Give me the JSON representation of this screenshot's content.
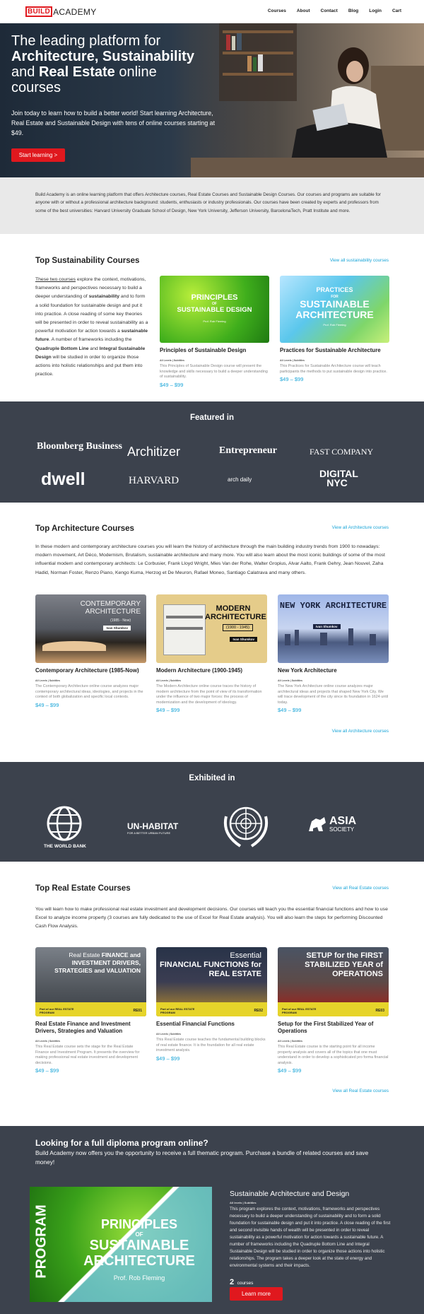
{
  "header": {
    "logo_build": "BUILD",
    "logo_rest": "ACADEMY",
    "nav": [
      "Courses",
      "About",
      "Contact",
      "Blog",
      "Login",
      "Cart"
    ]
  },
  "hero": {
    "line1": "The leading platform for",
    "line2_bold": "Architecture, Sustainability",
    "line3_pre": "and",
    "line3_bold": "Real Estate",
    "line3_post": "online",
    "line4": "courses",
    "text": "Join today to learn how to build a better world! Start learning Architecture, Real Estate and Sustainable Design with tens of online courses starting at $49.",
    "button": "Start learning >"
  },
  "intro": "Build Academy is an online learning platform that offers Architecture courses, Real Estate Courses and Sustainable Design Courses. Our courses and programs are suitable for anyone with or without a professional architecture background: students, enthusiasts or industry professionals. Our courses have been created by experts and professors from some of the best universities: Harvard University Graduate School of Design, New York University, Jefferson University, BarcelonaTech, Pratt Institute and more.",
  "sustainability": {
    "title": "Top Sustainability Courses",
    "link": "View all sustainability courses",
    "text_link": "These two courses",
    "text_a": " explore the context, motivations, frameworks and perspectives necessary to build a deeper understanding of ",
    "text_b1": "sustainability",
    "text_c": " and to form a solid foundation for sustainable design and put it into practice. A close reading of some key theories will be presented in order to reveal sustainability as a powerful motivation for action towards a ",
    "text_b2": "sustainable future",
    "text_d": ". A number of frameworks including the ",
    "text_b3": "Quadruple Bottom Line",
    "text_e": " and ",
    "text_b4": "Integral Sustainable Design",
    "text_f": " will be studied in order to organize those actions into holistic relationships and put them into practice.",
    "courses": [
      {
        "img_title1": "PRINCIPLES",
        "img_of": "OF",
        "img_title2": "SUSTAINABLE DESIGN",
        "img_author": "Prof. Rob Fleming",
        "title": "Principles of Sustainable Design",
        "level": "All Levels | Subtitles",
        "desc": "This Principles of Sustainable Design course will present the knowledge and skills necessary to build a deeper understanding of sustainability.",
        "price": "$49 – $99"
      },
      {
        "img_title1": "PRACTICES",
        "img_of": "FOR",
        "img_title2": "SUSTAINABLE ARCHITECTURE",
        "img_author": "Prof. Rob Fleming",
        "title": "Practices for Sustainable Architecture",
        "level": "All Levels | Subtitles",
        "desc": "This Practices for Sustainable Architecture course will teach participants the methods to put sustainable design into practice.",
        "price": "$49 – $99"
      }
    ]
  },
  "featured": {
    "title": "Featured in",
    "logos": [
      "Bloomberg Business",
      "Architizer",
      "Entrepreneur",
      "FAST COMPANY",
      "dwell",
      "HARVARD",
      "arch daily",
      "DIGITAL NYC"
    ]
  },
  "architecture": {
    "title": "Top Architecture Courses",
    "link": "View all Architecture courses",
    "text": "In these modern and contemporary architecture courses you will learn the history of architecture through the main building industry trends from 1900 to nowadays: modern movement, Art Déco, Modernism, Brutalism, sustainable architecture and many more. You will also learn about the most iconic buildings of some of the most influential modern and contemporary architects: Le Corbusier, Frank Lloyd Wright, Mies Van der Rohe, Walter Gropius, Alvar Aalto, Frank Gehry, Jean Nouvel, Zaha Hadid, Norman Foster, Renzo Piano, Kengo Kuma, Herzog et De Meuron, Rafael Moneo, Santiago Calatrava and many others.",
    "courses": [
      {
        "img_text": "CONTEMPORARY ARCHITECTURE",
        "img_sub": "(1985 - Now)",
        "img_author": "Ivan Shumkov",
        "title": "Contemporary Architecture (1985-Now)",
        "level": "All Levels | Subtitles",
        "desc": "The Contemporary Architecture online course analyzes major contemporary architectural ideas, ideologies, and projects in the context of both globalization and specific local contexts.",
        "price": "$49 – $99"
      },
      {
        "img_text": "MODERN ARCHITECTURE",
        "img_sub": "(1900 - 1945)",
        "img_author": "Ivan Shumkov",
        "title": "Modern Architecture (1900-1945)",
        "level": "All Levels | Subtitles",
        "desc": "The Modern Architecture online course traces the history of modern architecture from the point of view of its transformation under the influence of two major forces: the process of modernization and the development of ideology.",
        "price": "$49 – $99"
      },
      {
        "img_text": "NEW YORK ARCHITECTURE",
        "img_sub": "",
        "img_author": "Ivan Shumkov",
        "title": "New York Architecture",
        "level": "All Levels | Subtitles",
        "desc": "The New York Architecture online course analyzes major architectural ideas and projects that shaped New York City. We will trace development of the city since its foundation in 1624 until today.",
        "price": "$49 – $99"
      }
    ],
    "link_bottom": "View all Architecture courses"
  },
  "exhibited": {
    "title": "Exhibited in",
    "logos": [
      "THE WORLD BANK",
      "UN-HABITAT",
      "FOR A BETTER URBAN FUTURE",
      "ASIA",
      "SOCIETY"
    ]
  },
  "realestate": {
    "title": "Top Real Estate Courses",
    "link": "View all Real Estate courses",
    "text": "You will learn how to make professional real estate investment and development decisions. Our courses will teach you the essential financial functions and how to use Excel to analyze income property (3 courses are fully dedicated to the use of Excel for Real Estate analysis). You will also learn the steps for performing Discounted Cash Flow Analysis.",
    "courses": [
      {
        "img_a": "Real Estate",
        "img_b": "FINANCE and INVESTMENT DRIVERS, STRATEGIES and VALUATION",
        "program": "Part of our REAL ESTATE PROGRAM",
        "code": "RE01",
        "title": "Real Estate Finance and Investment Drivers, Strategies and Valuation",
        "level": "All Levels | Subtitles",
        "desc": "This Real Estate course sets the stage for the Real Estate Finance and Investment Program. It presents the overview for making professional real estate investment and development decisions.",
        "price": "$49 – $99"
      },
      {
        "img_a": "Essential",
        "img_b": "FINANCIAL FUNCTIONS for REAL ESTATE",
        "program": "Part of our REAL ESTATE PROGRAM",
        "code": "RE02",
        "title": "Essential Financial Functions",
        "level": "All Levels | Subtitles",
        "desc": "This Real Estate course teaches the fundamental building blocks of real estate finance. It is the foundation for all real estate investment analysis.",
        "price": "$49 – $99"
      },
      {
        "img_a": "SETUP for the FIRST",
        "img_b": "STABILIZED YEAR of OPERATIONS",
        "program": "Part of our REAL ESTATE PROGRAM",
        "code": "RE03",
        "title": "Setup for the First Stabilized Year of Operations",
        "level": "All Levels | Subtitles",
        "desc": "This Real Estate course is the starting point for all income property analysis and covers all of the topics that one must understand in order to develop a sophisticated pro forma financial analysis.",
        "price": "$49 – $99"
      }
    ],
    "link_bottom": "View all Real Estate courses"
  },
  "program": {
    "heading": "Looking for a full diploma program online?",
    "text": "Build Academy now offers you the opportunity to receive a full thematic program. Purchase a bundle of related courses and save money!",
    "img_vertical": "PROGRAM",
    "img_title1": "PRINCIPLES",
    "img_of": "OF",
    "img_title2": "SUSTAINABLE ARCHITECTURE",
    "img_author": "Prof. Rob Fleming",
    "title": "Sustainable Architecture and Design",
    "level": "All levels | Subtitles",
    "desc": "This program explores the context, motivations, frameworks and perspectives necessary to build a deeper understanding of sustainability and to form a solid foundation for sustainable design and put it into practice. A close reading of the first and second invisible hands of wealth will be presented in order to reveal sustainability as a powerful motivation for action towards a sustainable future. A number of frameworks including the Quadruple Bottom Line and Integral Sustainable Design will be studied in order to organize those actions into holistic relationships. The program takes a deeper look at the state of energy and environmental systems and their impacts.",
    "count": "2",
    "count_label": "courses",
    "button": "Learn more"
  }
}
